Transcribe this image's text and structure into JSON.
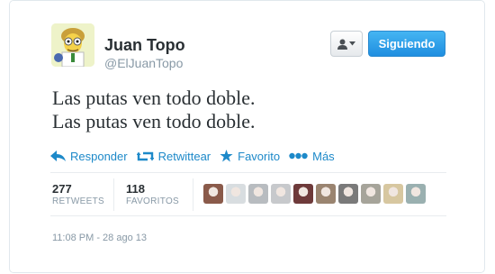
{
  "profile": {
    "name": "Juan Topo",
    "handle": "@ElJuanTopo",
    "follow_label": "Siguiendo"
  },
  "tweet": {
    "lines": [
      "Las putas ven todo doble.",
      "Las putas ven todo doble."
    ],
    "timestamp": "11:08 PM - 28 ago 13"
  },
  "actions": [
    {
      "label": "Responder",
      "icon": "reply-icon"
    },
    {
      "label": "Retwittear",
      "icon": "retweet-icon"
    },
    {
      "label": "Favorito",
      "icon": "star-icon"
    },
    {
      "label": "Más",
      "icon": "more-icon"
    }
  ],
  "stats": {
    "retweets": {
      "count": "277",
      "label": "RETWEETS"
    },
    "favorites": {
      "count": "118",
      "label": "FAVORITOS"
    }
  },
  "favoriters": [
    {
      "color": "#8a5a4a"
    },
    {
      "color": "#d8dde0"
    },
    {
      "color": "#b8bcc0"
    },
    {
      "color": "#c7c9cc"
    },
    {
      "color": "#6e3a3a"
    },
    {
      "color": "#9a8470"
    },
    {
      "color": "#7a7a7a"
    },
    {
      "color": "#a6a49a"
    },
    {
      "color": "#d7c7a0"
    },
    {
      "color": "#9ab0b0"
    }
  ],
  "colors": {
    "link": "#1d89c9",
    "follow_button": "#2b9ee6",
    "text": "#292f33",
    "muted": "#8899a6"
  }
}
